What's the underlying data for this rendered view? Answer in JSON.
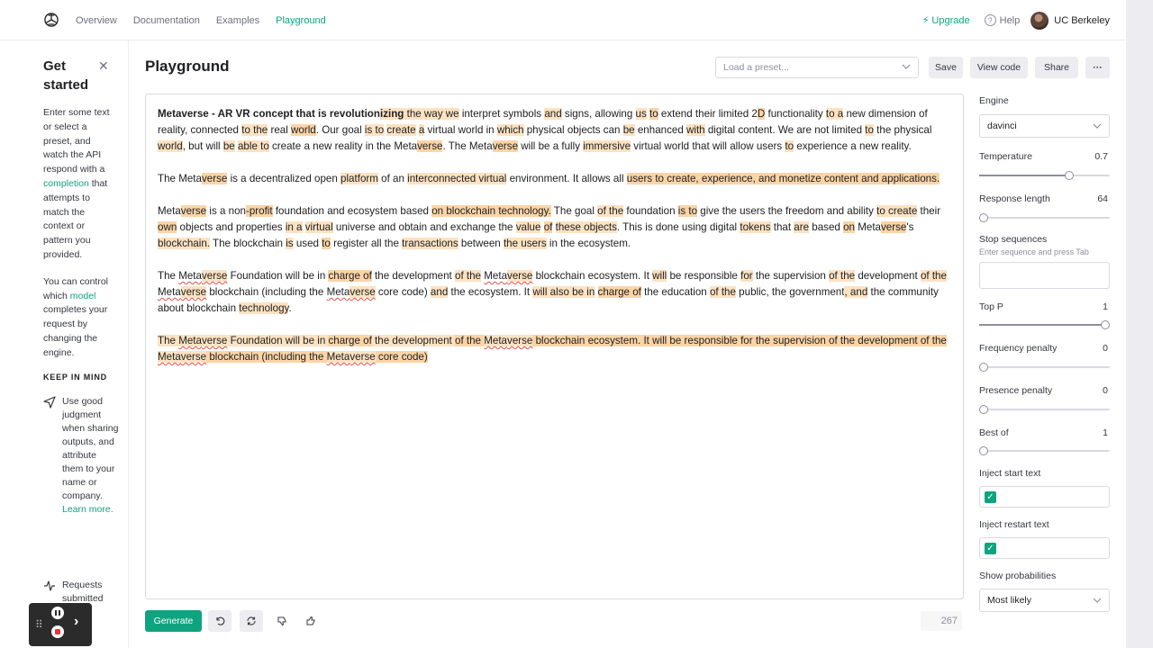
{
  "nav": {
    "links": [
      "Overview",
      "Documentation",
      "Examples",
      "Playground"
    ],
    "active": "Playground",
    "upgrade": "Upgrade",
    "help": "Help",
    "user": "UC Berkeley",
    "colors": {
      "accent": "#10a37f"
    }
  },
  "sidebar": {
    "title": "Get started",
    "p1_before": "Enter some text or select a preset, and watch the API respond with a",
    "p1_link": "completion",
    "p1_after": "that attempts to match the context or pattern you provided.",
    "p2_before": "You can control which",
    "p2_link": "model",
    "p2_after": "completes your request by changing the engine.",
    "keep_heading": "KEEP IN MIND",
    "tip1_text": "Use good judgment when sharing outputs, and attribute them to your name or company.",
    "tip1_link": "Learn more.",
    "tip2_text": "Requests submitted"
  },
  "main": {
    "title": "Playground",
    "preset_placeholder": "Load a preset...",
    "save": "Save",
    "view_code": "View code",
    "share": "Share",
    "more": "···",
    "generate": "Generate",
    "token_count": "267"
  },
  "settings": {
    "engine_label": "Engine",
    "engine_value": "davinci",
    "temperature_label": "Temperature",
    "temperature_value": "0.7",
    "response_length_label": "Response length",
    "response_length_value": "64",
    "stop_label": "Stop sequences",
    "stop_hint": "Enter sequence and press Tab",
    "top_p_label": "Top P",
    "top_p_value": "1",
    "freq_label": "Frequency penalty",
    "freq_value": "0",
    "presence_label": "Presence penalty",
    "presence_value": "0",
    "best_of_label": "Best of",
    "best_of_value": "1",
    "inject_start_label": "Inject start text",
    "inject_restart_label": "Inject restart text",
    "show_prob_label": "Show probabilities",
    "show_prob_value": "Most likely",
    "slider_levels": {
      "temperature": 0.7,
      "response_length": 0.0,
      "top_p": 1.0,
      "frequency": 0.0,
      "presence": 0.0,
      "best_of": 0.0
    }
  },
  "editor": {
    "paragraphs": [
      [
        [
          "Metaverse - AR VR concept that is revolution",
          "b"
        ],
        [
          "izing",
          "bh"
        ],
        [
          " the way ",
          "h"
        ],
        [
          "we",
          "h"
        ],
        [
          " interpret symbols ",
          ""
        ],
        [
          "and",
          "h"
        ],
        [
          " signs, allowing ",
          ""
        ],
        [
          "us",
          "h"
        ],
        [
          " ",
          ""
        ],
        [
          "to",
          "h2"
        ],
        [
          " extend their limited 2",
          ""
        ],
        [
          "D",
          "h2"
        ],
        [
          " functionality ",
          ""
        ],
        [
          "to a",
          "h"
        ],
        [
          " new dimension of reality, connected ",
          ""
        ],
        [
          "to the",
          "h"
        ],
        [
          " real ",
          ""
        ],
        [
          "world",
          "h2"
        ],
        [
          ". Our goal ",
          ""
        ],
        [
          "is to",
          "h"
        ],
        [
          " ",
          ""
        ],
        [
          "create",
          "h"
        ],
        [
          " ",
          ""
        ],
        [
          "a",
          "h"
        ],
        [
          " virtual world in ",
          ""
        ],
        [
          "which",
          "h"
        ],
        [
          " physical objects can ",
          ""
        ],
        [
          "be",
          "h"
        ],
        [
          " enhanced ",
          ""
        ],
        [
          "with",
          "h"
        ],
        [
          " digital content. We are not limited ",
          ""
        ],
        [
          "to",
          "h"
        ],
        [
          " the physical ",
          ""
        ],
        [
          "world",
          "h"
        ],
        [
          ", but will ",
          ""
        ],
        [
          "be",
          "h"
        ],
        [
          " ",
          ""
        ],
        [
          "able to",
          "h"
        ],
        [
          " create a new reality in the Meta",
          ""
        ],
        [
          "verse",
          "h2"
        ],
        [
          ". The Meta",
          ""
        ],
        [
          "verse",
          "h2"
        ],
        [
          " will be a fully ",
          ""
        ],
        [
          "immersive",
          "h"
        ],
        [
          " virtual world that will allow users ",
          ""
        ],
        [
          "to",
          "h"
        ],
        [
          " experience a new reality.",
          ""
        ]
      ],
      [
        [
          "The Meta",
          ""
        ],
        [
          "verse",
          "h2"
        ],
        [
          " is a decentralized open ",
          ""
        ],
        [
          "platform",
          "h"
        ],
        [
          " of an ",
          ""
        ],
        [
          "interconnected virtual",
          "h"
        ],
        [
          " environment. It allows all ",
          ""
        ],
        [
          "users to create, experience, and monetize content and applications.",
          "h2"
        ]
      ],
      [
        [
          "Meta",
          ""
        ],
        [
          "verse",
          "h2"
        ],
        [
          " is a non",
          ""
        ],
        [
          "-profit",
          "h2"
        ],
        [
          " foundation and ecosystem based ",
          ""
        ],
        [
          "on blockchain technology.",
          "h2"
        ],
        [
          " The goal ",
          ""
        ],
        [
          "of the",
          "h"
        ],
        [
          " foundation ",
          ""
        ],
        [
          "is to",
          "h2"
        ],
        [
          " give the users the freedom and ability ",
          ""
        ],
        [
          "to create",
          "h"
        ],
        [
          " their ",
          ""
        ],
        [
          "own",
          "h2"
        ],
        [
          " objects and properties ",
          ""
        ],
        [
          "in a",
          "h"
        ],
        [
          " ",
          ""
        ],
        [
          "virtual",
          "h"
        ],
        [
          " universe and obtain and exchange the ",
          ""
        ],
        [
          "value",
          "h"
        ],
        [
          " ",
          ""
        ],
        [
          "of",
          "h2"
        ],
        [
          " ",
          ""
        ],
        [
          "these objects",
          "h"
        ],
        [
          ". This is done using digital ",
          ""
        ],
        [
          "tokens",
          "h"
        ],
        [
          " that ",
          ""
        ],
        [
          "are",
          "h"
        ],
        [
          " based ",
          ""
        ],
        [
          "on",
          "h2"
        ],
        [
          " Meta",
          ""
        ],
        [
          "verse",
          "h2"
        ],
        [
          "'s ",
          ""
        ],
        [
          "blockchain.",
          "h"
        ],
        [
          " The blockchain ",
          ""
        ],
        [
          "is",
          "h"
        ],
        [
          " used ",
          ""
        ],
        [
          "to",
          "h2"
        ],
        [
          " register all the ",
          ""
        ],
        [
          "transactions",
          "h"
        ],
        [
          " between ",
          ""
        ],
        [
          "the users",
          "h"
        ],
        [
          " in the ecosystem.",
          ""
        ]
      ],
      [
        [
          "The ",
          ""
        ],
        [
          "Meta",
          "s"
        ],
        [
          "verse",
          "hs"
        ],
        [
          " Foundation will be in ",
          ""
        ],
        [
          "charge of",
          "h2"
        ],
        [
          " the development ",
          ""
        ],
        [
          "of the",
          "h"
        ],
        [
          " ",
          ""
        ],
        [
          "Meta",
          "s"
        ],
        [
          "verse",
          "hs"
        ],
        [
          " blockchain ecosystem. It ",
          ""
        ],
        [
          "will",
          "h"
        ],
        [
          " be responsible ",
          ""
        ],
        [
          "for",
          "h"
        ],
        [
          " the supervision ",
          ""
        ],
        [
          "of the",
          "h"
        ],
        [
          " development ",
          ""
        ],
        [
          "of the",
          "h"
        ],
        [
          " ",
          ""
        ],
        [
          "Meta",
          "s"
        ],
        [
          "verse",
          "hs"
        ],
        [
          " blockchain (including the ",
          ""
        ],
        [
          "Meta",
          "s"
        ],
        [
          "verse",
          "hs"
        ],
        [
          " core code) ",
          ""
        ],
        [
          "and",
          "h"
        ],
        [
          " the ecosystem. It ",
          ""
        ],
        [
          "will also be in",
          "h"
        ],
        [
          " ",
          ""
        ],
        [
          "charge of",
          "h2"
        ],
        [
          " the education ",
          ""
        ],
        [
          "of the",
          "h"
        ],
        [
          " public, the government",
          ""
        ],
        [
          ", and",
          "h"
        ],
        [
          " the community about blockchain ",
          ""
        ],
        [
          "technology",
          "h"
        ],
        [
          ".",
          ""
        ]
      ],
      [
        [
          "The ",
          "h"
        ],
        [
          "Meta",
          "hs"
        ],
        [
          "verse",
          "hs2"
        ],
        [
          " Foundation will be in ",
          "h"
        ],
        [
          "charge of",
          "h2"
        ],
        [
          " the development ",
          "h"
        ],
        [
          "of the ",
          "h2"
        ],
        [
          "Meta",
          "hs"
        ],
        [
          "verse",
          "hs2"
        ],
        [
          " blockchain ecosystem. It will be responsible for the supervision of the development of the ",
          "h2"
        ],
        [
          "Meta",
          "hs"
        ],
        [
          "verse",
          "hs2"
        ],
        [
          " blockchain (including the ",
          "h2"
        ],
        [
          "Meta",
          "hs"
        ],
        [
          "verse",
          "hs2"
        ],
        [
          " core code)",
          "h2"
        ]
      ]
    ]
  },
  "recorder": {
    "grip": "⠿",
    "next": "›"
  }
}
